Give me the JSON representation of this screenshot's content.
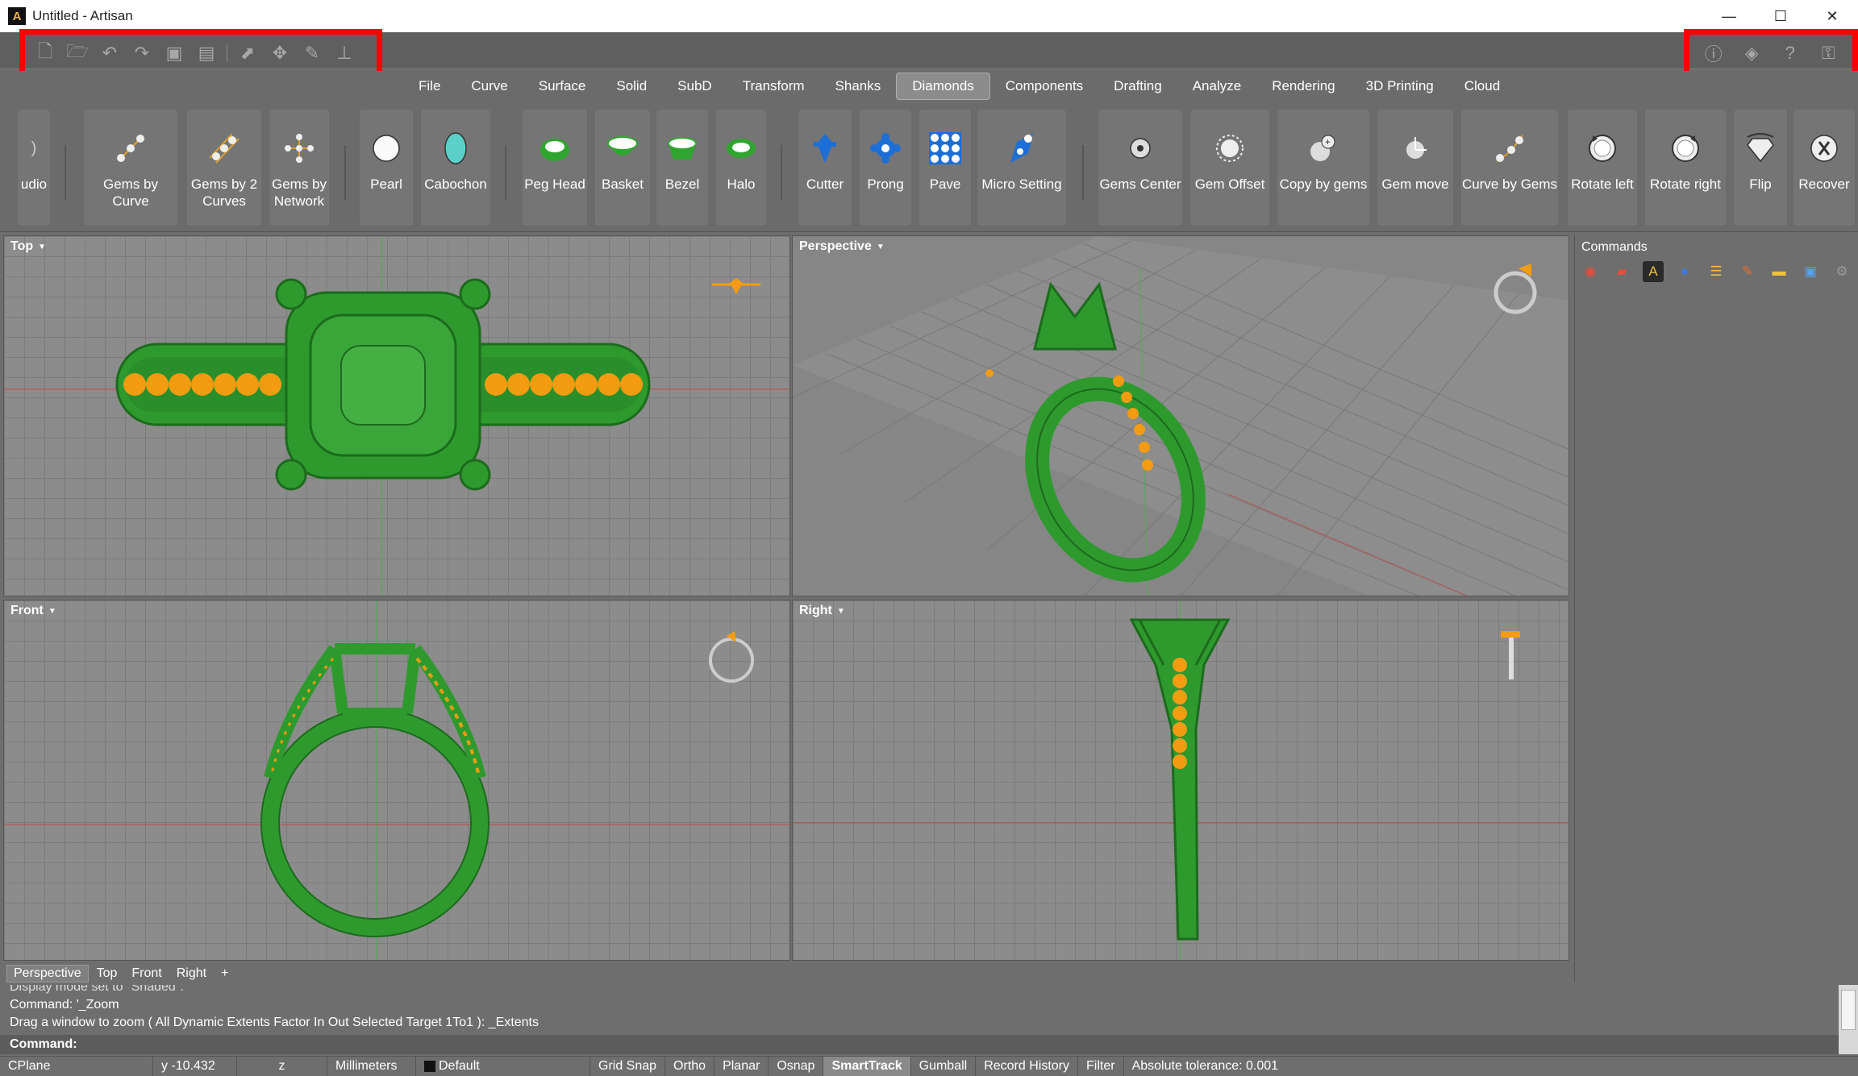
{
  "window": {
    "title": "Untitled - Artisan",
    "minimize": "—",
    "maximize": "☐",
    "close": "✕"
  },
  "menu": [
    "File",
    "Curve",
    "Surface",
    "Solid",
    "SubD",
    "Transform",
    "Shanks",
    "Diamonds",
    "Components",
    "Drafting",
    "Analyze",
    "Rendering",
    "3D Printing",
    "Cloud"
  ],
  "menu_active": "Diamonds",
  "ribbon": {
    "items": [
      {
        "label": "udio",
        "icon": "audio-icon"
      },
      {
        "label": "Gems by Curve",
        "icon": "gems-by-curve-icon"
      },
      {
        "label": "Gems by 2 Curves",
        "icon": "gems-by-2-curves-icon"
      },
      {
        "label": "Gems by Network",
        "icon": "gems-by-network-icon"
      },
      {
        "label": "Pearl",
        "icon": "pearl-icon"
      },
      {
        "label": "Cabochon",
        "icon": "cabochon-icon"
      },
      {
        "label": "Peg Head",
        "icon": "peg-head-icon"
      },
      {
        "label": "Basket",
        "icon": "basket-icon"
      },
      {
        "label": "Bezel",
        "icon": "bezel-icon"
      },
      {
        "label": "Halo",
        "icon": "halo-icon"
      },
      {
        "label": "Cutter",
        "icon": "cutter-icon"
      },
      {
        "label": "Prong",
        "icon": "prong-icon"
      },
      {
        "label": "Pave",
        "icon": "pave-icon"
      },
      {
        "label": "Micro Setting",
        "icon": "micro-setting-icon"
      },
      {
        "label": "Gems Center",
        "icon": "gems-center-icon"
      },
      {
        "label": "Gem Offset",
        "icon": "gem-offset-icon"
      },
      {
        "label": "Copy by gems",
        "icon": "copy-by-gems-icon"
      },
      {
        "label": "Gem move",
        "icon": "gem-move-icon"
      },
      {
        "label": "Curve by Gems",
        "icon": "curve-by-gems-icon"
      },
      {
        "label": "Rotate left",
        "icon": "rotate-left-icon"
      },
      {
        "label": "Rotate right",
        "icon": "rotate-right-icon"
      },
      {
        "label": "Flip",
        "icon": "flip-icon"
      },
      {
        "label": "Recover",
        "icon": "recover-icon"
      }
    ]
  },
  "viewports": {
    "top": "Top",
    "perspective": "Perspective",
    "front": "Front",
    "right": "Right"
  },
  "commands_panel": {
    "title": "Commands"
  },
  "viewport_tabs": [
    "Perspective",
    "Top",
    "Front",
    "Right",
    "+"
  ],
  "history": [
    "Display mode set to \"Shaded\".",
    "Command: '_Zoom",
    "Drag a window to zoom ( All  Dynamic  Extents  Factor  In  Out  Selected  Target  1To1 ): _Extents"
  ],
  "command_prompt": "Command:",
  "status": {
    "cplane": "CPlane",
    "y": "y -10.432",
    "z": "z",
    "units": "Millimeters",
    "layer": "Default",
    "toggles": [
      "Grid Snap",
      "Ortho",
      "Planar",
      "Osnap",
      "SmartTrack",
      "Gumball",
      "Record History",
      "Filter"
    ],
    "tolerance": "Absolute tolerance: 0.001"
  },
  "colors": {
    "gem": "#f39c12",
    "metal": "#2e9a2e",
    "highlight": "#ff0000"
  }
}
